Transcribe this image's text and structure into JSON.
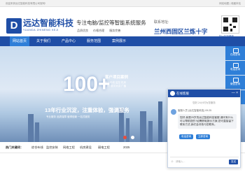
{
  "topbar": {
    "welcome": "欢迎来到远达智能科技有限公司官网!",
    "links": "网站地图 | 收藏本站"
  },
  "header": {
    "logo_mark": "D",
    "logo_cn": "远达智能科技",
    "logo_en": "YUANDA ZHINENG KEJI",
    "slogan": "专注电脑/监控等智能系统服务",
    "tags": [
      "品质优良",
      "价格合理",
      "服务完善"
    ],
    "contact_label": "联系地址:",
    "contact_address": "兰州西固区兰炼十字",
    "qr_caption": "扫一扫加微信"
  },
  "nav": {
    "items": [
      "网站首页",
      "关于我们",
      "产品中心",
      "服务范围",
      "案例展示"
    ],
    "active": 0
  },
  "banner": {
    "number": "100+",
    "cases_title": "客户项目案例",
    "case_lines": [
      "综合布线  监控  机房",
      "门禁  楼宇对讲  广播"
    ],
    "slogan": "13年行业沉淀，注重体验，强调服务",
    "sub": "专业服务  品质保障  值得信赖  一站式服务"
  },
  "news": {
    "items": [
      "热门关键词：",
      "综合布线",
      "监控安装",
      "网络工程",
      "机房建设",
      "弱电工程",
      "2025"
    ]
  },
  "chat": {
    "title": "在线客服",
    "controls": "— ×",
    "note": "您好,24小时为您服务",
    "agent": "客服人员 (远达智能科技) 09:25",
    "message": "您好,我是25岁的远达智能科技客服,请问有什么可以帮助您的?如需获取报价方案,您可直接留下联系方式,我们会尽快与您联系。",
    "quick_buttons": [
      "电话咨询",
      "立即咨询"
    ],
    "input_hint": "请输入...",
    "send": "发送"
  },
  "side": {
    "items": [
      "在线咨询",
      "电话咨询",
      "微信咨询",
      "返回顶部"
    ]
  }
}
